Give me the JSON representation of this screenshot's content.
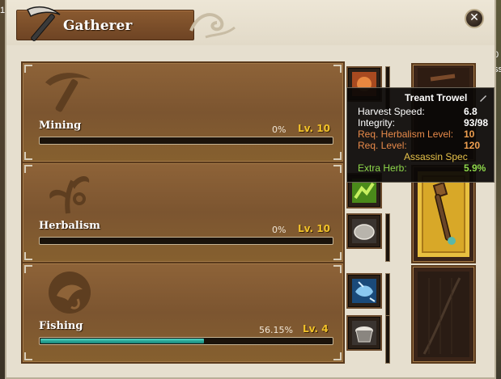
{
  "window": {
    "title": "Gatherer",
    "close_glyph": "✕"
  },
  "background": {
    "left_fragment": "1",
    "right_fragments": [
      "0",
      "ss"
    ]
  },
  "skills": [
    {
      "name": "Mining",
      "percent_text": "0%",
      "level_text": "Lv. 10",
      "progress": 0.0,
      "icon": "pickaxe-icon"
    },
    {
      "name": "Herbalism",
      "percent_text": "0%",
      "level_text": "Lv. 10",
      "progress": 0.0,
      "icon": "herb-icon"
    },
    {
      "name": "Fishing",
      "percent_text": "56.15%",
      "level_text": "Lv. 4",
      "progress": 0.5615,
      "icon": "fish-icon"
    }
  ],
  "tooltip": {
    "title": "Treant Trowel",
    "title_icon": "pencil-icon",
    "rows": [
      {
        "label": "Harvest Speed:",
        "value": "6.8",
        "label_color": "#ffffff",
        "value_color": "#ffffff"
      },
      {
        "label": "Integrity:",
        "value": "93/98",
        "label_color": "#ffffff",
        "value_color": "#ffffff"
      },
      {
        "label": "Req. Herbalism Level:",
        "value": "10",
        "label_color": "#e88a4a",
        "value_color": "#f0a050"
      },
      {
        "label": "Req. Level:",
        "value": "120",
        "label_color": "#e88a4a",
        "value_color": "#f0a050"
      }
    ],
    "spec_line": "Assassin Spec",
    "bonus": {
      "label": "Extra Herb:",
      "value": "5.9%",
      "label_color": "#8ed84a",
      "value_color": "#8ed84a"
    }
  },
  "colors": {
    "level_text": "#f2c229",
    "progress_fill": "#2aa898",
    "panel_brown": "#7c5530",
    "window_bg": "#e6dfcf"
  }
}
